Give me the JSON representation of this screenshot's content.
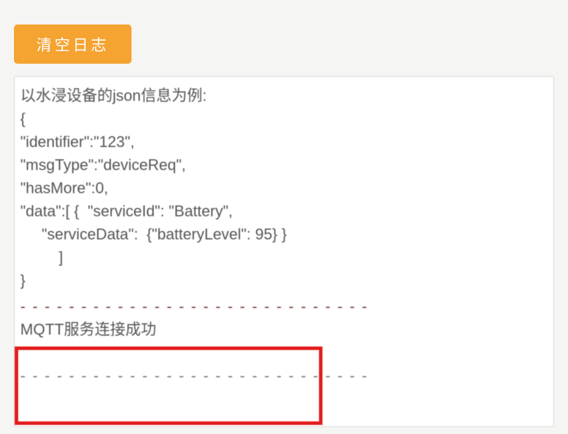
{
  "toolbar": {
    "clear_button_label": "清空日志"
  },
  "log": {
    "intro": "以水浸设备的json信息为例:",
    "blank": "",
    "brace_open": "{",
    "line_identifier": "\"identifier\":\"123\",",
    "line_msgtype": "\"msgType\":\"deviceReq\",",
    "line_hasmore": "\"hasMore\":0,",
    "line_data_open": "\"data\":[ {  \"serviceId\": \"Battery\",",
    "line_servicedata": "     \"serviceData\":  {\"batteryLevel\": 95} }",
    "line_bracket_close": "         ]",
    "brace_close": "}",
    "separator_top": "- - - - - - - - - - - - - - - - - - - - - - - - - - - - -",
    "mqtt_msg": "MQTT服务连接成功",
    "separator_bot": "- - - - - - - - - - - - - - - - - - - - - - - - - - - - -"
  }
}
